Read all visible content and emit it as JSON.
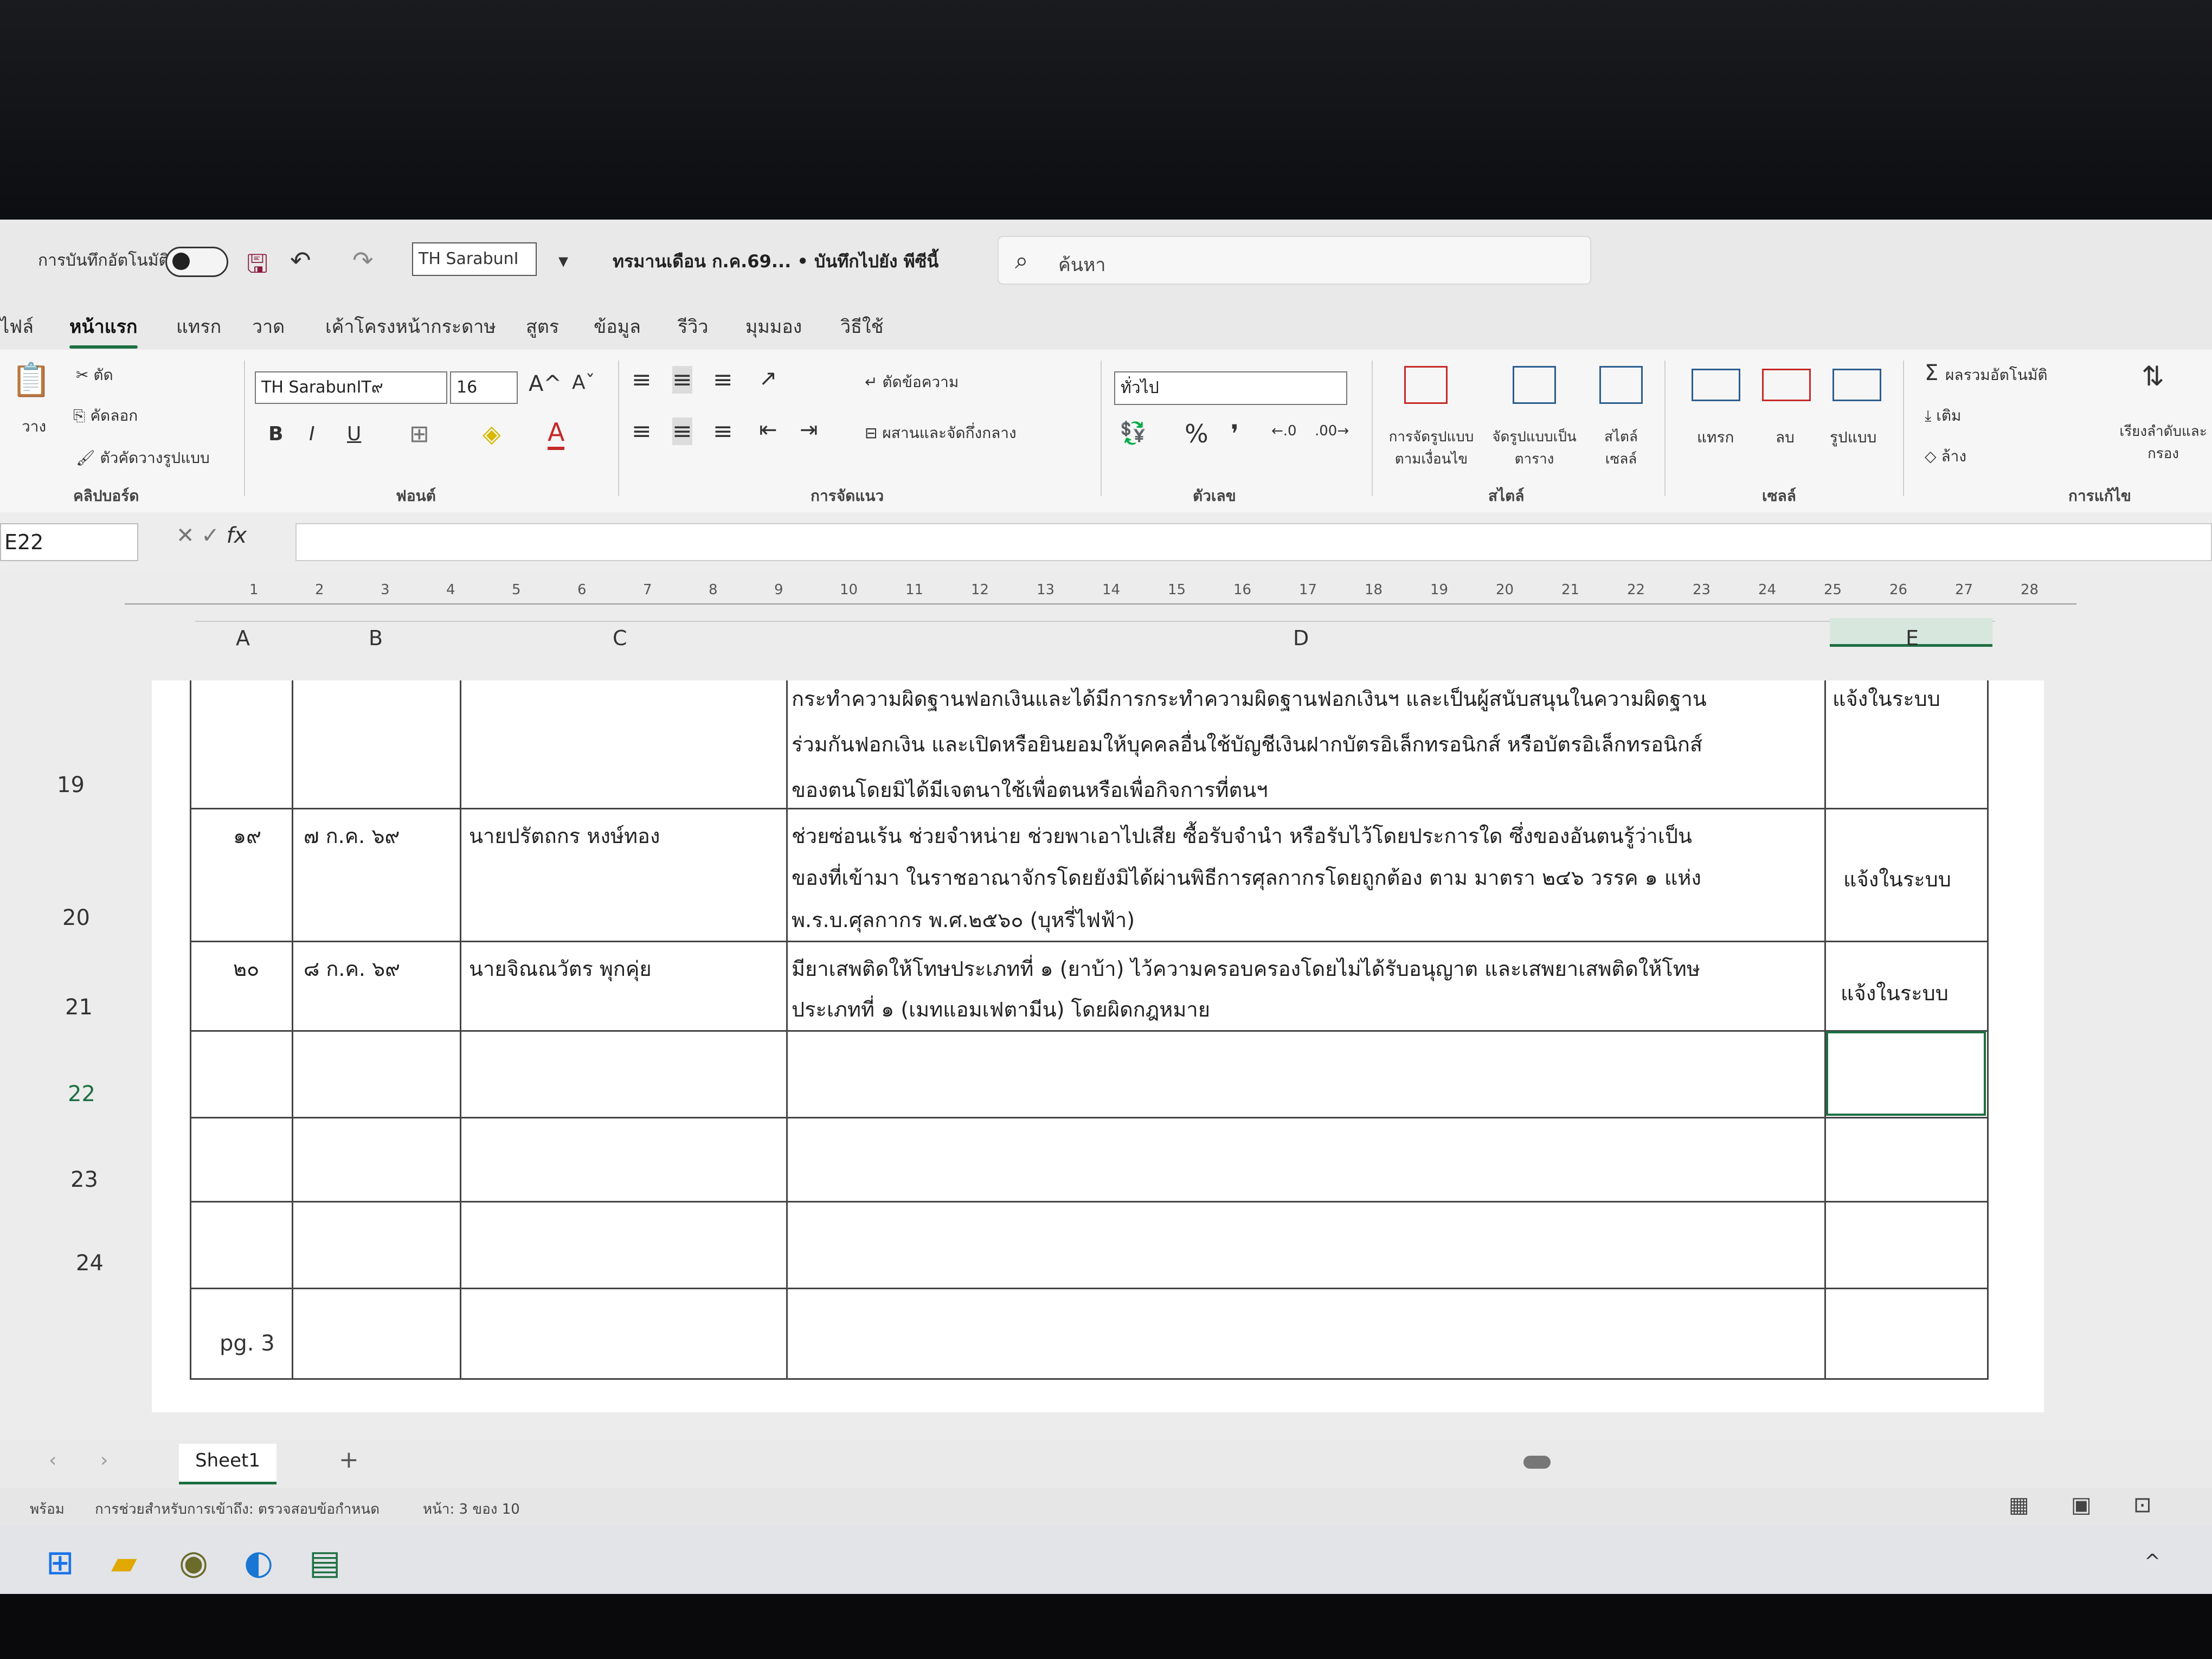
{
  "titlebar": {
    "autosave_label": "การบันทึกอัตโนมัติ",
    "font_name": "TH SarabunI",
    "doc_title": "ทรมานเดือน ก.ค.69... • บันทึกไปยัง พีซีนี้",
    "search_placeholder": "ค้นหา"
  },
  "tabs": [
    "ไฟล์",
    "หน้าแรก",
    "แทรก",
    "วาด",
    "เค้าโครงหน้ากระดาษ",
    "สูตร",
    "ข้อมูล",
    "รีวิว",
    "มุมมอง",
    "วิธีใช้"
  ],
  "ribbon": {
    "clipboard": {
      "paste": "วาง",
      "cut": "ตัด",
      "copy": "คัดลอก",
      "format_painter": "ตัวคัดวางรูปแบบ",
      "label": "คลิปบอร์ด"
    },
    "font": {
      "name": "TH SarabunIT๙",
      "size": "16",
      "bold": "B",
      "italic": "I",
      "underline": "U",
      "grow": "A^",
      "shrink": "Aˇ",
      "label": "ฟอนต์"
    },
    "alignment": {
      "wrap": "ตัดข้อความ",
      "merge": "ผสานและจัดกึ่งกลาง",
      "label": "การจัดแนว"
    },
    "number": {
      "format": "ทั่วไป",
      "percent": "%",
      "comma": "❜",
      "label": "ตัวเลข"
    },
    "styles": {
      "conditional": "การจัดรูปแบบตามเงื่อนไข",
      "table": "จัดรูปแบบเป็นตาราง",
      "cell_styles": "สไตล์เซลล์",
      "label": "สไตล์"
    },
    "cells": {
      "insert": "แทรก",
      "delete": "ลบ",
      "format": "รูปแบบ",
      "label": "เซลล์"
    },
    "editing": {
      "autosum": "ผลรวมอัตโนมัติ",
      "fill": "เติม",
      "clear": "ล้าง",
      "sort": "เรียงลำดับและกรอง",
      "label": "การแก้ไข"
    }
  },
  "formula_bar": {
    "name_box": "E22",
    "fx": "fx",
    "formula": ""
  },
  "ruler_ticks": [
    "1",
    "2",
    "3",
    "4",
    "5",
    "6",
    "7",
    "8",
    "9",
    "10",
    "11",
    "12",
    "13",
    "14",
    "15",
    "16",
    "17",
    "18",
    "19",
    "20",
    "21",
    "22",
    "23",
    "24",
    "25",
    "26",
    "27",
    "28"
  ],
  "columns": [
    "A",
    "B",
    "C",
    "D",
    "E"
  ],
  "rows": [
    {
      "num": "19",
      "a": "",
      "b": "",
      "c": "",
      "d_lines": [
        "กระทำความผิดฐานฟอกเงินและได้มีการกระทำความผิดฐานฟอกเงินฯ และเป็นผู้สนับสนุนในความผิดฐาน",
        "ร่วมกันฟอกเงิน และเปิดหรือยินยอมให้บุคคลอื่นใช้บัญชีเงินฝากบัตรอิเล็กทรอนิกส์ หรือบัตรอิเล็กทรอนิกส์",
        "ของตนโดยมิได้มีเจตนาใช้เพื่อตนหรือเพื่อกิจการที่ตนฯ"
      ],
      "e": "แจ้งในระบบ"
    },
    {
      "num": "20",
      "a": "๑๙",
      "b": "๗ ก.ค. ๖๙",
      "c": "นายปรัตถกร หงษ์ทอง",
      "d_lines": [
        "ช่วยซ่อนเร้น ช่วยจำหน่าย ช่วยพาเอาไปเสีย ซื้อรับจำนำ หรือรับไว้โดยประการใด ซึ่งของอันตนรู้ว่าเป็น",
        "ของที่เข้ามา ในราชอาณาจักรโดยยังมิได้ผ่านพิธีการศุลกากรโดยถูกต้อง ตาม มาตรา ๒๔๖ วรรค ๑ แห่ง",
        "พ.ร.บ.ศุลกากร พ.ศ.๒๕๖๐ (บุหรี่ไฟฟ้า)"
      ],
      "e": "แจ้งในระบบ"
    },
    {
      "num": "21",
      "a": "๒๐",
      "b": "๘ ก.ค. ๖๙",
      "c": "นายจิณณวัตร พุกคุ่ย",
      "d_lines": [
        "มียาเสพติดให้โทษประเภทที่ ๑ (ยาบ้า) ไว้ความครอบครองโดยไม่ได้รับอนุญาต และเสพยาเสพติดให้โทษ",
        "ประเภทที่ ๑ (เมทแอมเฟตามีน) โดยผิดกฎหมาย"
      ],
      "e": "แจ้งในระบบ"
    },
    {
      "num": "22"
    },
    {
      "num": "23"
    },
    {
      "num": "24"
    }
  ],
  "page_footer": "pg. 3",
  "sheet_tab": "Sheet1",
  "status": {
    "ready": "พร้อม",
    "accessibility": "การช่วยสำหรับการเข้าถึง: ตรวจสอบข้อกำหนด",
    "page": "หน้า: 3 ของ 10"
  },
  "colors": {
    "excel_green": "#1d6f42"
  }
}
